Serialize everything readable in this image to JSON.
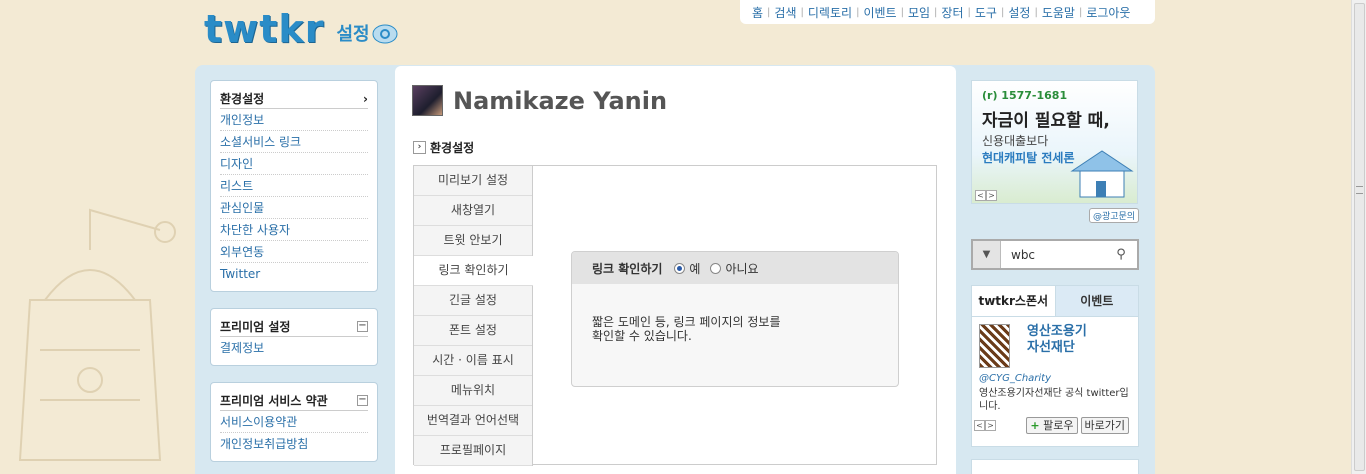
{
  "topnav": [
    "홈",
    "검색",
    "디렉토리",
    "이벤트",
    "모임",
    "장터",
    "도구",
    "설정",
    "도움말",
    "로그아웃"
  ],
  "logo": {
    "word": "twtkr",
    "sub": "설정"
  },
  "left": {
    "settings": {
      "title": "환경설정",
      "chevron": "›",
      "items": [
        "개인정보",
        "소셜서비스 링크",
        "디자인",
        "리스트",
        "관심인물",
        "차단한 사용자",
        "외부연동",
        "Twitter"
      ]
    },
    "premium": {
      "title": "프리미엄 설정",
      "toggle": "−",
      "items": [
        "결제정보"
      ]
    },
    "terms": {
      "title": "프리미엄 서비스 약관",
      "toggle": "−",
      "items": [
        "서비스이용약관",
        "개인정보취급방침"
      ]
    }
  },
  "profile": {
    "name": "Namikaze Yanin"
  },
  "crumb": {
    "arrow": "›",
    "label": "환경설정"
  },
  "tabs": [
    "미리보기 설정",
    "새창열기",
    "트윗 안보기",
    "링크 확인하기",
    "긴글 설정",
    "폰트 설정",
    "시간 · 이름 표시",
    "메뉴위치",
    "번역결과 언어선택",
    "프로필페이지"
  ],
  "active_tab_index": 3,
  "setting": {
    "label": "링크 확인하기",
    "options": [
      "예",
      "아니요"
    ],
    "selected": "예",
    "desc1": "짧은 도메인 등, 링크 페이지의 정보를",
    "desc2": "확인할 수 있습니다."
  },
  "ad": {
    "tel": "(r) 1577-1681",
    "line1": "자금이 필요할 때,",
    "line2": "신용대출보다",
    "line3": "현대캐피탈 전세론",
    "prev": "<",
    "next": ">",
    "link": "@광고문의"
  },
  "search": {
    "value": "wbc",
    "dropdown": "▼",
    "icon": "⚲"
  },
  "sponsor": {
    "tab1": "twtkr스폰서",
    "tab2": "이벤트",
    "org_name_1": "영산조용기",
    "org_name_2": "자선재단",
    "account": "@CYG_Charity",
    "desc": "영산조용기자선재단 공식 twitter입니다.",
    "prev": "<",
    "next": ">",
    "follow_plus": "+",
    "follow": "팔로우",
    "go": "바로가기"
  }
}
